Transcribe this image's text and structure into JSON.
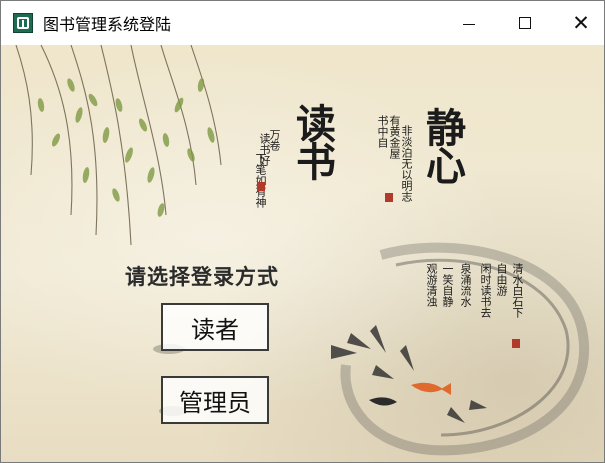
{
  "window": {
    "title": "图书管理系统登陆",
    "icon": "app-book-icon",
    "controls": {
      "minimize": "minimize-icon",
      "maximize": "maximize-icon",
      "close_glyph": "✕"
    }
  },
  "decor": {
    "calligraphy_left": "读书",
    "calligraphy_right": "静心",
    "poem_left": [
      "读书好",
      "万卷",
      "下笔如有神"
    ],
    "poem_right": [
      "书中自",
      "有黄金屋",
      "非淡泊无以明志"
    ],
    "poem_bottom": [
      "清水白石下",
      "自由游",
      "闲时读书去",
      "泉涌流水",
      "一笑自静",
      "观游清浊"
    ],
    "seal_color": "#b23a2a"
  },
  "login": {
    "prompt": "请选择登录方式",
    "reader_button": "读者",
    "admin_button": "管理员"
  }
}
